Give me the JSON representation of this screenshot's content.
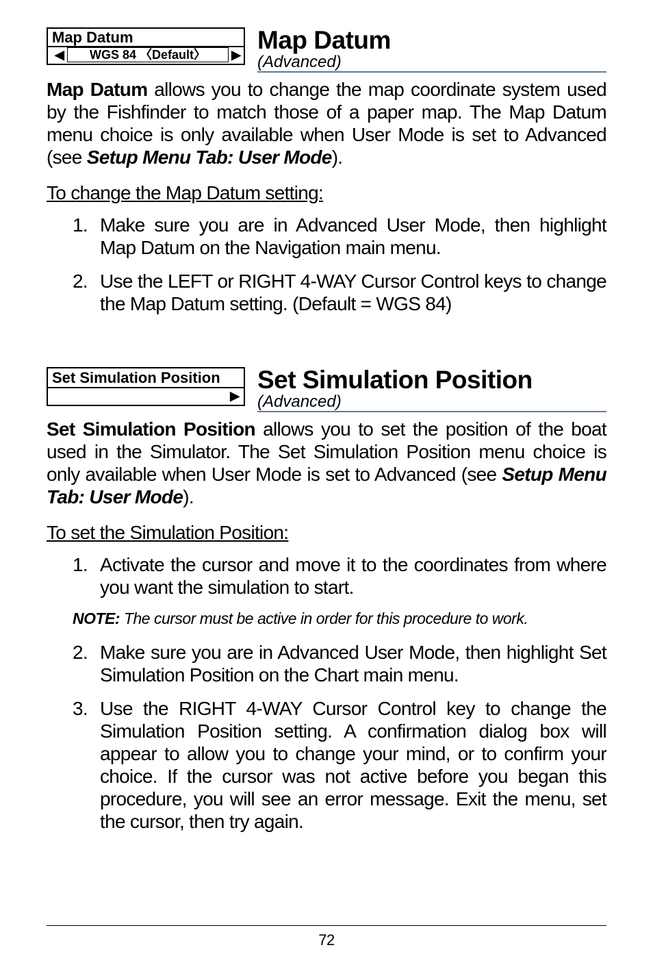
{
  "s1": {
    "widget": {
      "label": "Map Datum",
      "value": "WGS 84 〈Default〉"
    },
    "title": "Map Datum",
    "subtitle": "(Advanced)",
    "body_lead": "Map Datum",
    "body_rest": " allows you to change the map coordinate system used by the Fishfinder to match those of a paper map. The Map Datum menu choice is only available when User Mode is set to Advanced (see ",
    "body_em": "Setup Menu Tab: User Mode",
    "body_tail": ").",
    "howto": "To change the Map Datum setting:",
    "steps": [
      "Make sure you are in Advanced User Mode, then highlight Map Datum on the Navigation main menu.",
      "Use the LEFT or RIGHT 4-WAY Cursor Control keys to change the Map Datum setting. (Default = WGS 84)"
    ]
  },
  "s2": {
    "widget": {
      "label": "Set Simulation Position"
    },
    "title": "Set Simulation Position",
    "subtitle": "(Advanced)",
    "body_lead": "Set Simulation Position",
    "body_rest": " allows you to set the position of the boat used in the Simulator. The Set Simulation Position menu choice is only available when User Mode is set to Advanced (see ",
    "body_em": "Setup Menu Tab: User Mode",
    "body_tail": ").",
    "howto": "To set the Simulation Position:",
    "steps_a": [
      "Activate the cursor and move it to the coordinates from where you want the simulation to start."
    ],
    "note_label": "NOTE:",
    "note_text": " The cursor must be active in order for this procedure to work.",
    "steps_b": [
      "Make sure you are in Advanced User Mode, then highlight Set Simulation Position on the Chart main menu.",
      "Use the RIGHT 4-WAY Cursor Control key to change the Simulation Position setting.  A confirmation dialog box will appear to allow you to change your mind, or to confirm your choice. If the cursor was not active before you began this procedure, you will see an error message. Exit the menu, set the cursor, then try again."
    ]
  },
  "page": "72"
}
